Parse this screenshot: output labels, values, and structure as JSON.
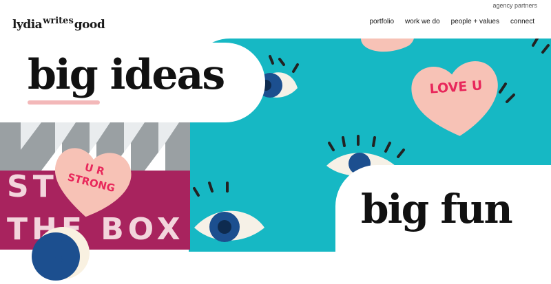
{
  "topbar": {
    "partners_label": "agency partners",
    "logo": {
      "part1": "lydia",
      "part2": "writes",
      "part3": "good"
    },
    "nav": [
      "portfolio",
      "work we do",
      "people + values",
      "connect"
    ]
  },
  "hero": {
    "headline_1": "big ideas",
    "headline_2": "big fun",
    "heart_left_text": "U R STRONG",
    "heart_right_text": "LOVE U",
    "bg_words": [
      "ST OU",
      "THE BOX"
    ]
  },
  "colors": {
    "teal": "#16b8c4",
    "magenta": "#a8235e",
    "heart": "#f7c2b6",
    "heart_text": "#e8275b",
    "navy": "#1c4f8f"
  },
  "icons": [
    "eye-icon",
    "arrow-down-icon"
  ]
}
